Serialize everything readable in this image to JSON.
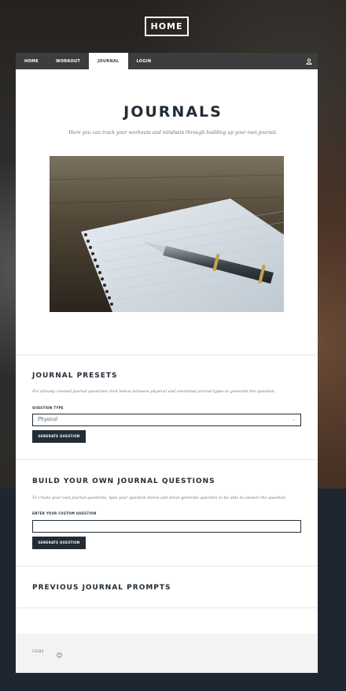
{
  "header": {
    "home_label": "HOME"
  },
  "nav": {
    "items": [
      {
        "label": "HOME"
      },
      {
        "label": "WORKOUT"
      },
      {
        "label": "JOURNAL"
      },
      {
        "label": "LOGIN"
      }
    ],
    "active_index": 2,
    "user_icon": "user-icon"
  },
  "main": {
    "title": "JOURNALS",
    "subtitle": "Here you can track your workouts and mindsets through building up your own journal."
  },
  "presets": {
    "heading": "JOURNAL PRESETS",
    "description": "For already created journal questions click below between physical and emotional journal types to generate the question.",
    "field_label": "QUESTION TYPE",
    "selected_value": "Physical",
    "button_label": "GENERATE QUESTION"
  },
  "custom": {
    "heading": "BUILD YOUR OWN JOURNAL QUESTIONS",
    "description": "To create your own journal questions, type your question below and press generate question to be able to answer the question.",
    "field_label": "ENTER YOUR CUSTOM QUESTION",
    "input_value": "",
    "button_label": "GENERATE QUESTION"
  },
  "previous": {
    "heading": "PREVIOUS JOURNAL PROMPTS"
  },
  "footer": {
    "text": "CS184",
    "icon": "github-icon"
  },
  "colors": {
    "dark": "#222c36",
    "nav_bg": "#3d3d3d",
    "footer_bg": "#f3f3f3"
  }
}
